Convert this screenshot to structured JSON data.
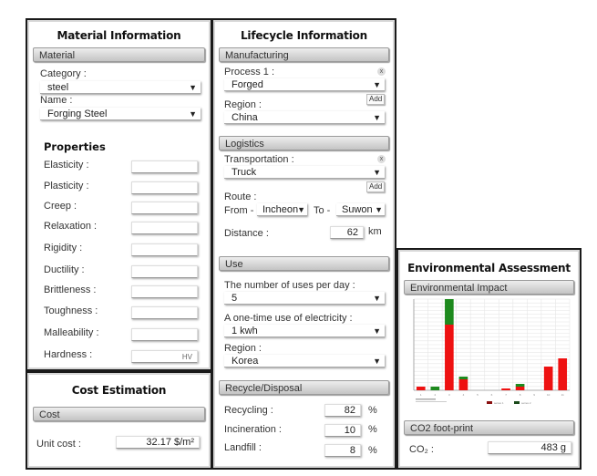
{
  "material_panel": {
    "title": "Material Information",
    "section": "Material",
    "category_label": "Category :",
    "category_value": "steel",
    "name_label": "Name :",
    "name_value": "Forging Steel",
    "properties_title": "Properties",
    "properties": [
      {
        "label": "Elasticity :",
        "value": ""
      },
      {
        "label": "Plasticity :",
        "value": ""
      },
      {
        "label": "Creep :",
        "value": ""
      },
      {
        "label": "Relaxation :",
        "value": ""
      },
      {
        "label": "Rigidity :",
        "value": ""
      },
      {
        "label": "Ductility :",
        "value": ""
      },
      {
        "label": "Brittleness :",
        "value": ""
      },
      {
        "label": "Toughness :",
        "value": ""
      },
      {
        "label": "Malleability :",
        "value": ""
      },
      {
        "label": "Hardness :",
        "value": "",
        "unit": "HV"
      }
    ]
  },
  "cost_panel": {
    "title": "Cost Estimation",
    "section": "Cost",
    "unit_cost_label": "Unit cost :",
    "unit_cost_value": "32.17 $/m²"
  },
  "lifecycle_panel": {
    "title": "Lifecycle Information",
    "manufacturing": {
      "section": "Manufacturing",
      "process_label": "Process 1 :",
      "process_value": "Forged",
      "remove_label": "x",
      "add_label": "Add",
      "region_label": "Region :",
      "region_value": "China"
    },
    "logistics": {
      "section": "Logistics",
      "transport_label": "Transportation :",
      "transport_value": "Truck",
      "remove_label": "x",
      "add_label": "Add",
      "route_label": "Route :",
      "from_label": "From -",
      "from_value": "Incheon",
      "to_label": "To -",
      "to_value": "Suwon",
      "distance_label": "Distance :",
      "distance_value": "62",
      "distance_unit": "km"
    },
    "use": {
      "section": "Use",
      "uses_label": "The number of uses per day :",
      "uses_value": "5",
      "electricity_label": "A one-time use of electricity :",
      "electricity_value": "1 kwh",
      "region_label": "Region :",
      "region_value": "Korea"
    },
    "recycle": {
      "section": "Recycle/Disposal",
      "recycling_label": "Recycling :",
      "recycling_value": "82",
      "incineration_label": "Incineration :",
      "incineration_value": "10",
      "landfill_label": "Landfill :",
      "landfill_value": "8",
      "percent": "%"
    }
  },
  "env_panel": {
    "title": "Environmental Assessment",
    "section": "Environmental Impact",
    "co2_section": "CO2 foot-print",
    "co2_label": "CO₂ :",
    "co2_value": "483 g"
  },
  "colors": {
    "red_series": "#ee1111",
    "green_series": "#1e8a1e"
  },
  "chart_data": {
    "type": "bar",
    "stacked": true,
    "title": "",
    "xlabel": "",
    "ylabel": "",
    "categories": [
      "1",
      "2",
      "3",
      "4",
      "5",
      "6",
      "7",
      "8",
      "9",
      "10",
      "11"
    ],
    "series": [
      {
        "name": "series 1",
        "color": "#ee1111",
        "values": [
          4,
          0,
          72,
          12,
          0,
          0,
          2,
          4,
          0,
          26,
          35
        ]
      },
      {
        "name": "series 2",
        "color": "#1e8a1e",
        "values": [
          0,
          4,
          28,
          3,
          0,
          0,
          0,
          3,
          0,
          0,
          0
        ]
      }
    ],
    "ylim": [
      0,
      100
    ],
    "grid": true,
    "legend": "bottom"
  }
}
